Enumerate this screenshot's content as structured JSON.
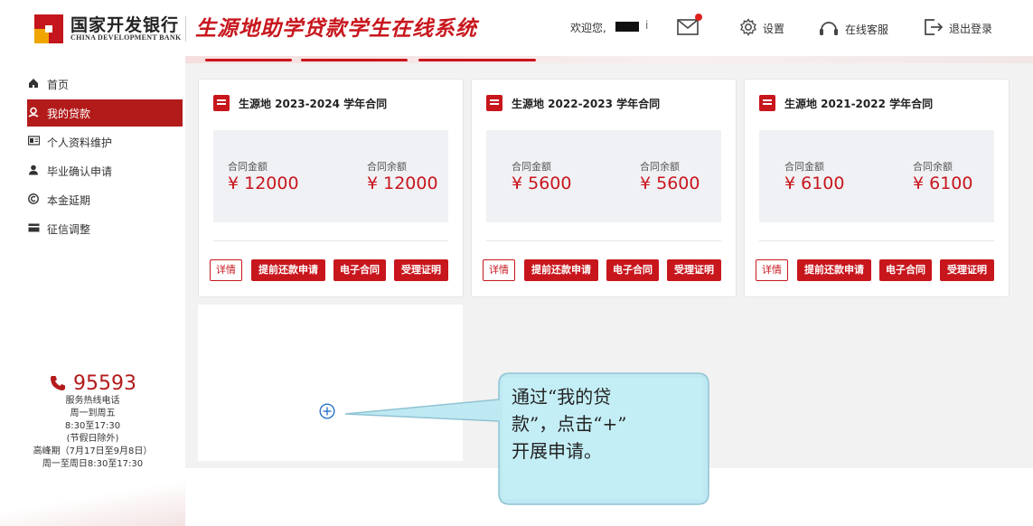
{
  "header": {
    "bank_name_cn": "国家开发银行",
    "bank_name_en": "CHINA DEVELOPMENT BANK",
    "system_title": "生源地助学贷款学生在线系统",
    "welcome": "欢迎您,",
    "user_suffix": "i",
    "settings_label": "设置",
    "service_label": "在线客服",
    "logout_label": "退出登录"
  },
  "sidebar": {
    "items": [
      {
        "label": "首页",
        "icon": "home-icon"
      },
      {
        "label": "我的贷款",
        "icon": "loan-icon"
      },
      {
        "label": "个人资料维护",
        "icon": "id-card-icon"
      },
      {
        "label": "毕业确认申请",
        "icon": "graduate-icon"
      },
      {
        "label": "本金延期",
        "icon": "copyright-icon"
      },
      {
        "label": "征信调整",
        "icon": "credit-card-icon"
      }
    ],
    "active_index": 1,
    "hotline": {
      "number": "95593",
      "label": "服务热线电话",
      "days": "周一到周五",
      "hours": "8:30至17:30",
      "holiday": "(节假日除外)",
      "peak": "高峰期（7月17日至9月8日）",
      "peak_hours": "周一至周日8:30至17:30"
    }
  },
  "contracts": [
    {
      "title": "生源地 2023-2024 学年合同",
      "amount_label": "合同金额",
      "amount": "¥ 12000",
      "balance_label": "合同余额",
      "balance": "¥ 12000"
    },
    {
      "title": "生源地 2022-2023 学年合同",
      "amount_label": "合同金额",
      "amount": "¥ 5600",
      "balance_label": "合同余额",
      "balance": "¥ 5600"
    },
    {
      "title": "生源地 2021-2022 学年合同",
      "amount_label": "合同金额",
      "amount": "¥ 6100",
      "balance_label": "合同余额",
      "balance": "¥ 6100"
    }
  ],
  "buttons": {
    "details": "详情",
    "prepay": "提前还款申请",
    "econtract": "电子合同",
    "certificate": "受理证明"
  },
  "callout": {
    "line1": "通过“我的贷",
    "line2": "款”，点击“+”",
    "line3": "开展申请。"
  },
  "colors": {
    "brand": "#c8161d",
    "sidebar_active": "#b31b1b",
    "callout_bg": "#c8f2f7"
  }
}
